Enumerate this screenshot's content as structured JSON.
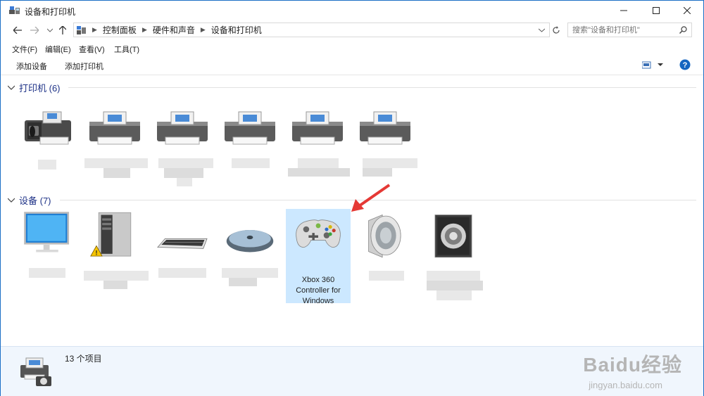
{
  "window": {
    "title": "设备和打印机"
  },
  "address": {
    "breadcrumbs": [
      "控制面板",
      "硬件和声音",
      "设备和打印机"
    ],
    "search_placeholder": "搜索\"设备和打印机\""
  },
  "menu": [
    "文件(F)",
    "编辑(E)",
    "查看(V)",
    "工具(T)"
  ],
  "commands": {
    "add_device": "添加设备",
    "add_printer": "添加打印机"
  },
  "printers_group": {
    "title": "打印机 (6)",
    "items": [
      {
        "icon": "fax-printer-icon"
      },
      {
        "icon": "printer-icon"
      },
      {
        "icon": "printer-icon"
      },
      {
        "icon": "printer-icon"
      },
      {
        "icon": "printer-icon"
      },
      {
        "icon": "printer-icon"
      }
    ]
  },
  "devices_group": {
    "title": "设备 (7)",
    "items": [
      {
        "icon": "monitor-icon"
      },
      {
        "icon": "computer-tower-icon",
        "warning": true
      },
      {
        "icon": "keyboard-icon"
      },
      {
        "icon": "mouse-icon"
      },
      {
        "icon": "gamepad-icon",
        "label_lines": [
          "Xbox 360",
          "Controller for",
          "Windows"
        ],
        "selected": true
      },
      {
        "icon": "speaker-icon"
      },
      {
        "icon": "speaker-box-icon"
      }
    ]
  },
  "status": {
    "count": "13 个项目"
  },
  "watermark": {
    "brand": "Baidu经验",
    "url": "jingyan.baidu.com"
  },
  "colors": {
    "accent": "#1c6fc6",
    "group_title": "#1e3287",
    "selection": "#cce8ff",
    "arrow": "#e53935"
  }
}
